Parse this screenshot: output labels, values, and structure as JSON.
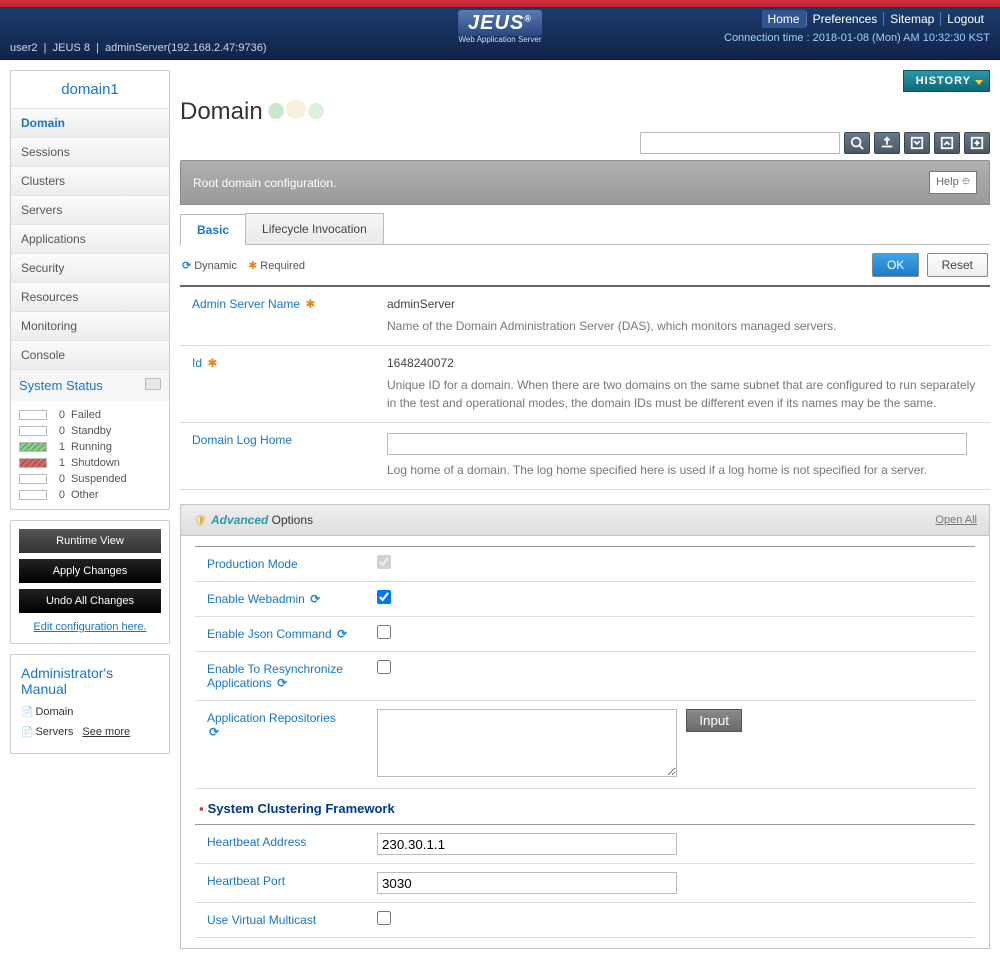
{
  "header": {
    "links": [
      "Home",
      "Preferences",
      "Sitemap",
      "Logout"
    ],
    "active_link": 0,
    "user": "user2",
    "product": "JEUS 8",
    "server": "adminServer(192.168.2.47:9736)",
    "conn_label": "Connection time :",
    "conn_time": "2018-01-08 (Mon) AM 10:32:30 KST",
    "logo_main": "JEUS",
    "logo_sub": "Web Application Server",
    "logo_reg": "®"
  },
  "sidebar": {
    "domain_name": "domain1",
    "nav": [
      "Domain",
      "Sessions",
      "Clusters",
      "Servers",
      "Applications",
      "Security",
      "Resources",
      "Monitoring",
      "Console"
    ],
    "nav_active": 0,
    "status_title": "System Status",
    "statuses": [
      {
        "count": 0,
        "label": "Failed",
        "swatch": "sw-empty"
      },
      {
        "count": 0,
        "label": "Standby",
        "swatch": "sw-empty"
      },
      {
        "count": 1,
        "label": "Running",
        "swatch": "sw-green"
      },
      {
        "count": 1,
        "label": "Shutdown",
        "swatch": "sw-red"
      },
      {
        "count": 0,
        "label": "Suspended",
        "swatch": "sw-empty"
      },
      {
        "count": 0,
        "label": "Other",
        "swatch": "sw-empty"
      }
    ],
    "actions": {
      "runtime": "Runtime View",
      "apply": "Apply Changes",
      "undo": "Undo All Changes",
      "edit_link": "Edit configuration here."
    },
    "manual": {
      "title": "Administrator's Manual",
      "items": [
        "Domain",
        "Servers"
      ],
      "see_more": "See more"
    }
  },
  "main": {
    "history": "HISTORY",
    "page_title": "Domain",
    "subtitle": "Root domain configuration.",
    "help": "Help",
    "tabs": [
      "Basic",
      "Lifecycle Invocation"
    ],
    "tabs_active": 0,
    "legend_dynamic": "Dynamic",
    "legend_required": "Required",
    "btn_ok": "OK",
    "btn_reset": "Reset",
    "fields": {
      "admin_name": {
        "label": "Admin Server Name",
        "value": "adminServer",
        "desc": "Name of the Domain Administration Server (DAS), which monitors managed servers."
      },
      "id": {
        "label": "Id",
        "value": "1648240072",
        "desc": "Unique ID for a domain. When there are two domains on the same subnet that are configured to run separately in the test and operational modes, the domain IDs must be different even if its names may be the same."
      },
      "log_home": {
        "label": "Domain Log Home",
        "value": "",
        "desc": "Log home of a domain. The log home specified here is used if a log home is not specified for a server."
      }
    },
    "advanced": {
      "title_italic": "Advanced",
      "title_rest": " Options",
      "open_all": "Open All",
      "prod_mode": {
        "label": "Production Mode",
        "checked": true
      },
      "enable_web": {
        "label": "Enable Webadmin",
        "checked": true
      },
      "enable_json": {
        "label": "Enable Json Command",
        "checked": false
      },
      "enable_resync": {
        "label": "Enable To Resynchronize Applications",
        "checked": false
      },
      "app_repos": {
        "label": "Application Repositories",
        "value": "",
        "input_btn": "Input"
      },
      "cluster_title": "System Clustering Framework",
      "hb_addr": {
        "label": "Heartbeat Address",
        "value": "230.30.1.1"
      },
      "hb_port": {
        "label": "Heartbeat Port",
        "value": "3030"
      },
      "use_vm": {
        "label": "Use Virtual Multicast",
        "checked": false
      }
    }
  }
}
